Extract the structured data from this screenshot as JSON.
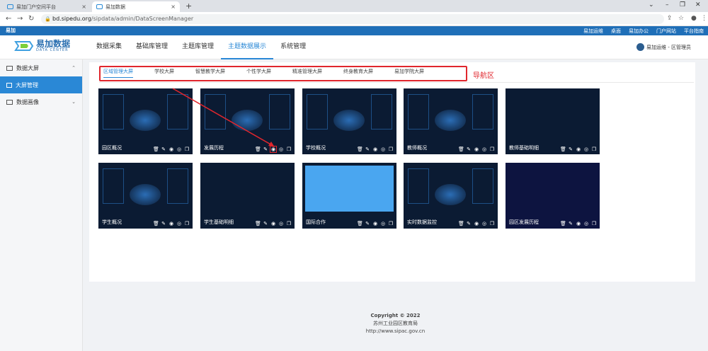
{
  "browser": {
    "tabs": [
      {
        "label": "易加门户空间平台"
      },
      {
        "label": "易加数据"
      }
    ],
    "url_domain": "bd.sipedu.org",
    "url_path": "/sipdata/admin/DataScreenManager"
  },
  "topbar": {
    "brand": "易加",
    "links": [
      "易加运维",
      "桌面",
      "易加办公",
      "门户网站",
      "平台指南"
    ]
  },
  "header": {
    "logo_title": "易加数据",
    "logo_sub": "DATA CENTER",
    "nav": [
      "数据采集",
      "基础库管理",
      "主题库管理",
      "主题数据展示",
      "系统管理"
    ],
    "active_nav": "主题数据展示",
    "user": "易加运维 - 区管理员"
  },
  "sidebar": {
    "groups": [
      {
        "label": "数据大屏",
        "expanded": true,
        "items": [
          {
            "label": "大屏管理",
            "active": true
          }
        ]
      },
      {
        "label": "数据画像",
        "expanded": false,
        "items": []
      }
    ]
  },
  "subnav": {
    "tabs": [
      "区域管理大屏",
      "学校大屏",
      "智慧教学大屏",
      "个性学大屏",
      "精准管理大屏",
      "终身教育大屏",
      "易加学院大屏"
    ],
    "active": "区域管理大屏",
    "annotation": "导航区"
  },
  "screens": [
    {
      "caption": "园区概况",
      "style": "dark-blue"
    },
    {
      "caption": "发展历程",
      "style": "dark-charts"
    },
    {
      "caption": "学校概况",
      "style": "dark-table"
    },
    {
      "caption": "教师概况",
      "style": "dark-bars"
    },
    {
      "caption": "教师基础明细",
      "style": "dark"
    },
    {
      "caption": "学生概况",
      "style": "dark-radar"
    },
    {
      "caption": "学生基础明细",
      "style": "dark"
    },
    {
      "caption": "国际合作",
      "style": "light-blue"
    },
    {
      "caption": "实时数据监控",
      "style": "dark-chart"
    },
    {
      "caption": "园区发展历程",
      "style": "dark-deep"
    }
  ],
  "footer": {
    "copyright": "Copyright © 2022",
    "org": "苏州工业园区教育局",
    "url": "http://www.sipac.gov.cn"
  },
  "colors": {
    "accent": "#2a88d6",
    "topbar": "#1f6fb8",
    "annotation": "#e0262d",
    "screen_bg": "#0b1b33"
  }
}
